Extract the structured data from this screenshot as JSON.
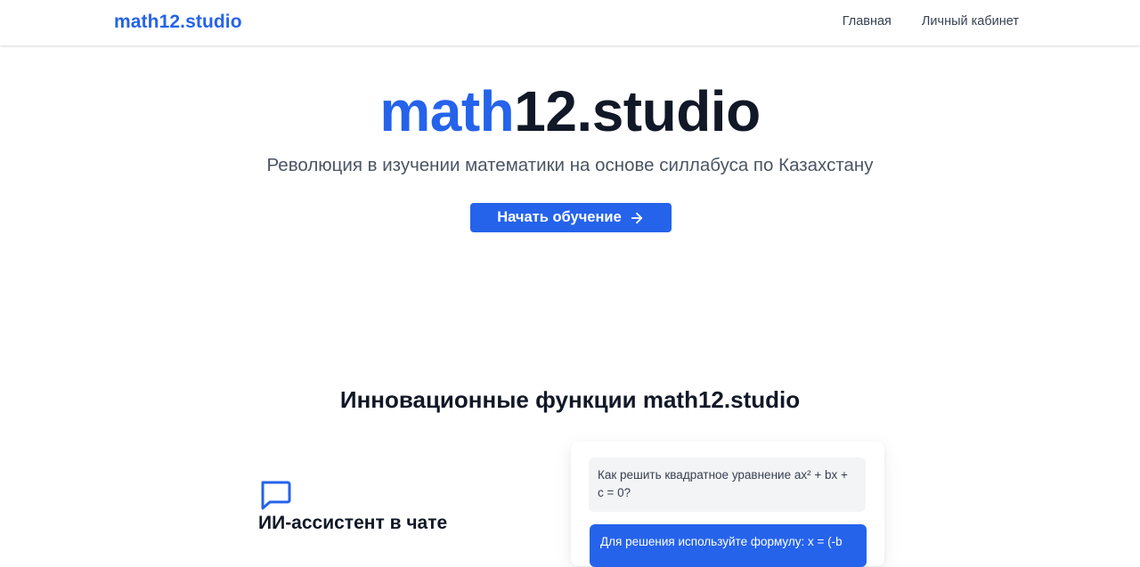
{
  "header": {
    "logo": "math12.studio",
    "nav": [
      {
        "label": "Главная"
      },
      {
        "label": "Личный кабинет"
      }
    ]
  },
  "hero": {
    "title_accent": "math",
    "title_rest": "12.studio",
    "subtitle": "Революция в изучении математики на основе силлабуса по Казахстану",
    "cta_label": "Начать обучение",
    "cta_icon": "arrow-right-icon"
  },
  "features": {
    "title": "Инновационные функции math12.studio",
    "items": [
      {
        "icon": "chat-bubble-icon",
        "title": "ИИ-ассистент в чате"
      }
    ],
    "chat_demo": {
      "question": "Как решить квадратное уравнение ax² + bx + c = 0?",
      "answer": "Для решения используйте формулу: x = (-b"
    }
  },
  "colors": {
    "brand": "#2563eb",
    "text": "#111827",
    "muted": "#4b5563"
  }
}
